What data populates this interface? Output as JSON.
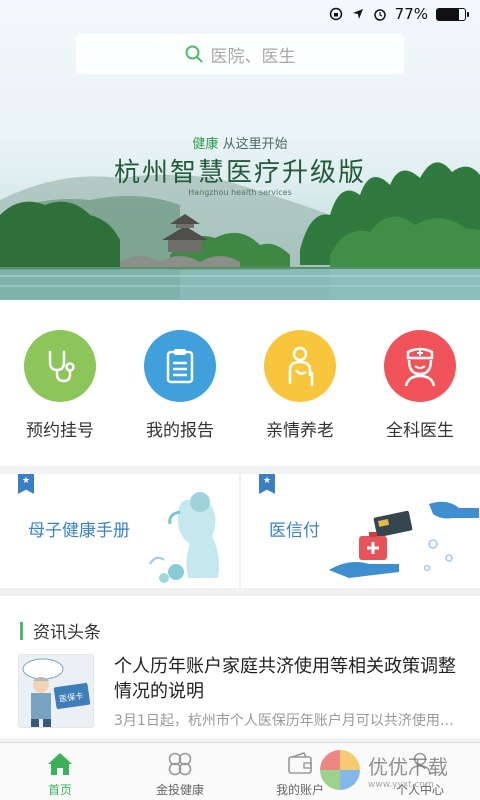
{
  "status_bar": {
    "battery_text": "77%",
    "battery_level": 0.77
  },
  "search": {
    "placeholder": "医院、医生"
  },
  "banner": {
    "subtitle_accent": "健康",
    "subtitle_rest": "从这里开始",
    "title": "杭州智慧医疗升级版",
    "subtitle_en": "Hangzhou health services"
  },
  "quick_actions": [
    {
      "label": "预约挂号",
      "color": "#8cc55a",
      "icon": "stethoscope-icon"
    },
    {
      "label": "我的报告",
      "color": "#3fa0dc",
      "icon": "clipboard-icon"
    },
    {
      "label": "亲情养老",
      "color": "#f8c63d",
      "icon": "elderly-icon"
    },
    {
      "label": "全科医生",
      "color": "#f0545a",
      "icon": "doctor-icon"
    }
  ],
  "feature_cards": [
    {
      "label": "母子健康手册",
      "icon": "pregnant-mother-icon"
    },
    {
      "label": "医信付",
      "icon": "card-payment-icon"
    }
  ],
  "news": {
    "heading": "资讯头条",
    "items": [
      {
        "title": "个人历年账户家庭共济使用等相关政策调整情况的说明",
        "desc": "3月1日起，杭州市个人医保历年账户月可以共济使用…",
        "thumb_text": "医保卡"
      }
    ]
  },
  "tab_bar": [
    {
      "label": "首页",
      "icon": "home-icon",
      "active": true
    },
    {
      "label": "金投健康",
      "icon": "clover-icon",
      "active": false
    },
    {
      "label": "我的账户",
      "icon": "wallet-icon",
      "active": false
    },
    {
      "label": "个人中心",
      "icon": "person-icon",
      "active": false
    }
  ],
  "watermark": {
    "brand": "优优下载",
    "url": "www.yyxt.com"
  },
  "colors": {
    "accent_green": "#3cb15a",
    "card_blue": "#3b82c4"
  }
}
